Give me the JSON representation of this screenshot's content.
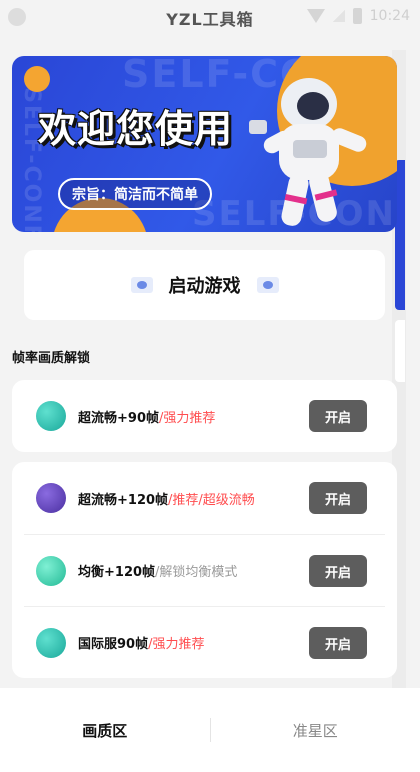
{
  "status_bar": {
    "time": "10:24"
  },
  "app": {
    "title": "YZL工具箱"
  },
  "banner": {
    "title": "欢迎您使用",
    "subtitle": "宗旨：简洁而不简单",
    "ghost_text_1": "SELF-CONFIDE",
    "ghost_text_2": "SELF-CONFIDEN",
    "ghost_text_vertical": "SELF-CONF"
  },
  "launch": {
    "label": "启动游戏"
  },
  "section": {
    "title": "帧率画质解锁"
  },
  "rows": [
    {
      "title": "超流畅+90帧",
      "note": "/强力推荐",
      "button": "开启",
      "dot_color": "#1aa89a"
    },
    {
      "title": "超流畅+120帧",
      "note": "/推荐/超级流畅",
      "button": "开启",
      "dot_color": "#5b3fb0"
    },
    {
      "title": "均衡+120帧",
      "note": "/解锁均衡模式",
      "button": "开启",
      "dot_color": "#26c2a3"
    },
    {
      "title": "国际服90帧",
      "note": "/强力推荐",
      "button": "开启",
      "dot_color": "#1aa89a"
    }
  ],
  "bottom_nav": {
    "tab1": "画质区",
    "tab2": "准星区"
  },
  "colors": {
    "accent_blue": "#2a46d6",
    "orange": "#f4a531",
    "button": "#5d5d5d",
    "red_note": "#ff4d4f"
  }
}
